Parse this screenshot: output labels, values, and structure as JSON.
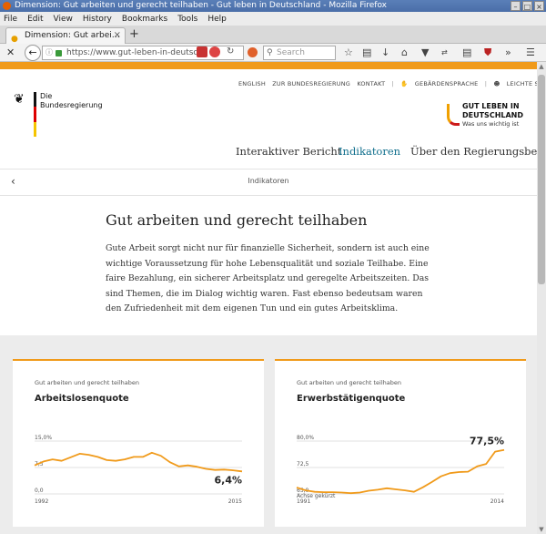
{
  "window": {
    "title": "Dimension: Gut arbeiten und gerecht teilhaben - Gut leben in Deutschland - Mozilla Firefox",
    "buttons": [
      "–",
      "□",
      "×"
    ]
  },
  "menu": [
    "File",
    "Edit",
    "View",
    "History",
    "Bookmarks",
    "Tools",
    "Help"
  ],
  "tab": {
    "label": "Dimension: Gut arbei…",
    "close": "×",
    "new": "+"
  },
  "nav": {
    "url": "https://www.gut-leben-in-deutsch",
    "search_placeholder": "Search"
  },
  "site": {
    "logo_text": "Die Bundesregierung",
    "toplinks": [
      "ENGLISH",
      "ZUR BUNDESREGIERUNG",
      "KONTAKT",
      "GEBÄRDENSPRACHE",
      "LEICHTE SPRACHE"
    ],
    "brand_title_1": "GUT LEBEN IN",
    "brand_title_2": "DEUTSCHLAND",
    "brand_sub": "Was uns wichtig ist",
    "mainnav": [
      "Interaktiver Bericht",
      "Indikatoren",
      "Über den Regierungsbericht"
    ],
    "mainnav_active": 1,
    "breadcrumb": "Indikatoren",
    "headline": "Gut arbeiten und gerecht teilhaben",
    "intro": "Gute Arbeit sorgt nicht nur für finanzielle Sicherheit, sondern ist auch eine wichtige Voraussetzung für hohe Lebensqualität und soziale Teilhabe. Eine faire Bezahlung, ein sicherer Arbeitsplatz und geregelte Arbeitszeiten. Das sind Themen, die im Dialog wichtig waren. Fast ebenso bedeutsam waren den Zufriedenheit mit dem eigenen Tun und ein gutes Arbeitsklima.",
    "colors": {
      "accent": "#f09a1a",
      "nav_active": "#0f6e8c"
    }
  },
  "chart_data": [
    {
      "type": "line",
      "category": "Gut arbeiten und gerecht teilhaben",
      "title": "Arbeitslosenquote",
      "x": [
        1992,
        1993,
        1994,
        1995,
        1996,
        1997,
        1998,
        1999,
        2000,
        2001,
        2002,
        2003,
        2004,
        2005,
        2006,
        2007,
        2008,
        2009,
        2010,
        2011,
        2012,
        2013,
        2014,
        2015
      ],
      "values": [
        8.1,
        9.2,
        9.8,
        9.4,
        10.4,
        11.4,
        11.1,
        10.5,
        9.6,
        9.4,
        9.8,
        10.5,
        10.5,
        11.7,
        10.8,
        9.0,
        7.8,
        8.1,
        7.7,
        7.1,
        6.8,
        6.9,
        6.7,
        6.4
      ],
      "yticks": [
        "15,0%",
        "7,5",
        "0,0"
      ],
      "ytick_values": [
        15,
        7.5,
        0
      ],
      "ylim": [
        0,
        15
      ],
      "xlabels": [
        "1992",
        "2015"
      ],
      "last_label": "6,4%",
      "color": "#f09a1a"
    },
    {
      "type": "line",
      "category": "Gut arbeiten und gerecht teilhaben",
      "title": "Erwerbstätigenquote",
      "x": [
        1991,
        1992,
        1993,
        1994,
        1995,
        1996,
        1997,
        1998,
        1999,
        2000,
        2001,
        2002,
        2003,
        2004,
        2005,
        2006,
        2007,
        2008,
        2009,
        2010,
        2011,
        2012,
        2013,
        2014
      ],
      "values": [
        66.8,
        66.0,
        65.6,
        65.5,
        65.5,
        65.4,
        65.2,
        65.4,
        65.9,
        66.2,
        66.6,
        66.3,
        66.0,
        65.6,
        66.9,
        68.4,
        70.0,
        70.9,
        71.2,
        71.3,
        72.8,
        73.5,
        77.0,
        77.5
      ],
      "yticks": [
        "80,0%",
        "72,5",
        "65,0"
      ],
      "ytick_values": [
        80,
        72.5,
        65
      ],
      "ylim": [
        65,
        80
      ],
      "xlabels": [
        "1991",
        "2014"
      ],
      "axis_note": "Achse gekürzt",
      "last_label": "77,5%",
      "color": "#f09a1a"
    }
  ]
}
